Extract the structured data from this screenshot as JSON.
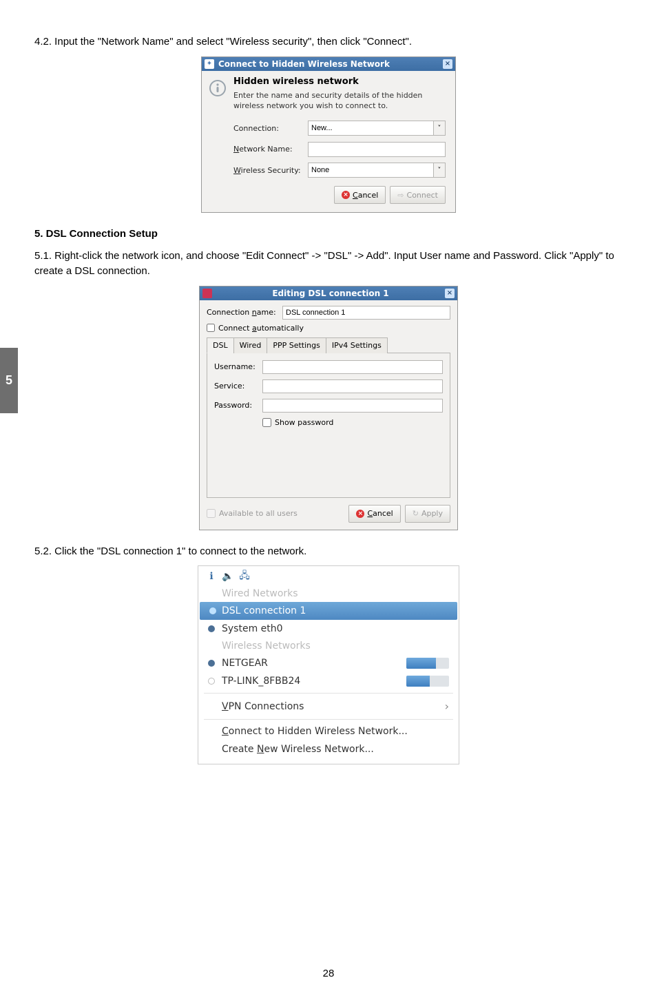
{
  "side_tab": "5",
  "page_number": "28",
  "para_4_2": "4.2. Input the \"Network Name\" and select \"Wireless security\", then click \"Connect\".",
  "heading_5": "5. DSL Connection Setup",
  "para_5_1": "5.1. Right-click the network icon, and choose \"Edit Connect\" -> \"DSL\" -> Add\". Input User name and Password. Click \"Apply\" to create a DSL connection.",
  "para_5_2": "5.2. Click the \"DSL connection 1\" to connect to the network.",
  "dlg1": {
    "title": "Connect to Hidden Wireless Network",
    "heading": "Hidden wireless network",
    "desc": "Enter the name and security details of the hidden wireless network you wish to connect to.",
    "lbl_connection": "Connection:",
    "val_connection": "New...",
    "lbl_network_name_prefix": "N",
    "lbl_network_name_rest": "etwork Name:",
    "lbl_wireless_security_prefix": "W",
    "lbl_wireless_security_rest": "ireless Security:",
    "val_wireless_security": "None",
    "btn_cancel_prefix": "C",
    "btn_cancel_rest": "ancel",
    "btn_connect": "Connect"
  },
  "dlg2": {
    "title": "Editing DSL connection 1",
    "lbl_conn_name_pre": "Connection ",
    "lbl_conn_name_u": "n",
    "lbl_conn_name_post": "ame:",
    "val_conn_name": "DSL connection 1",
    "chk_auto_pre": "Connect ",
    "chk_auto_u": "a",
    "chk_auto_post": "utomatically",
    "tabs": [
      "DSL",
      "Wired",
      "PPP Settings",
      "IPv4 Settings"
    ],
    "lbl_username": "Username:",
    "lbl_service": "Service:",
    "lbl_password": "Password:",
    "chk_showpw": "Show password",
    "chk_avail": "Available to all users",
    "btn_cancel_prefix": "C",
    "btn_cancel_rest": "ancel",
    "btn_apply": "Apply"
  },
  "menu3": {
    "sec_wired": "Wired Networks",
    "item_dsl": "DSL connection 1",
    "item_eth": "System eth0",
    "sec_wireless": "Wireless Networks",
    "item_netgear": "NETGEAR",
    "item_tplink": "TP-LINK_8FBB24",
    "item_vpn_u": "V",
    "item_vpn_rest": "PN Connections",
    "item_hidden_u": "C",
    "item_hidden_rest": "onnect to Hidden Wireless Network...",
    "item_create_pre": "Create ",
    "item_create_u": "N",
    "item_create_post": "ew Wireless Network...",
    "sig_netgear_pct": 70,
    "sig_tplink_pct": 55
  }
}
